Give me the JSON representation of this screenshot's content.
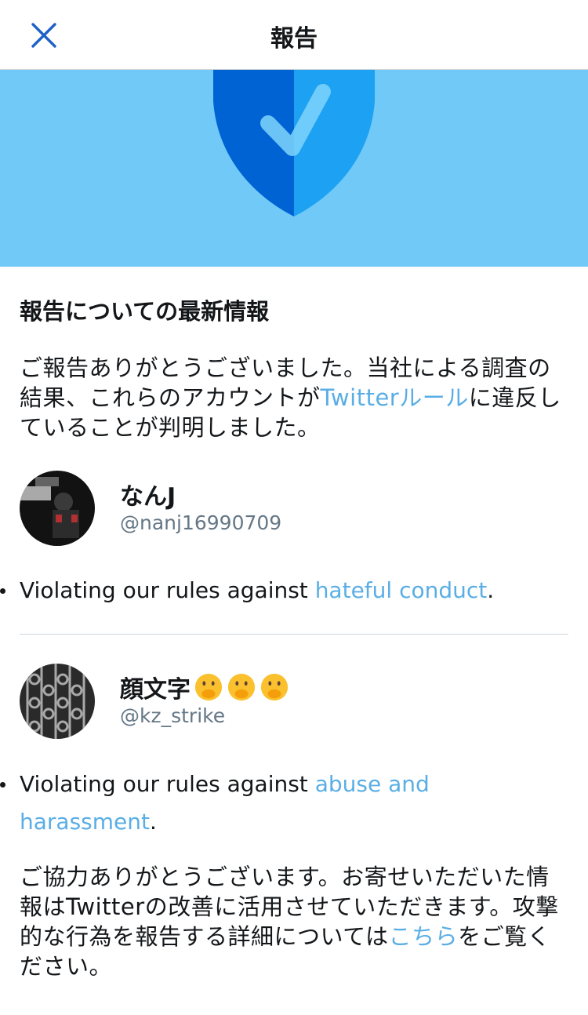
{
  "header": {
    "close_icon": "close-icon",
    "title": "報告"
  },
  "hero": {
    "icon": "shield-check-icon",
    "background_color": "#71c9f8"
  },
  "section": {
    "title": "報告についての最新情報",
    "intro_text": "ご報告ありがとうございました。当社による調査の結果、これらのアカウントが",
    "intro_link": "Twitterルール",
    "intro_suffix": "に違反していることが判明しました。"
  },
  "accounts": [
    {
      "name": "なんJ",
      "handle": "@nanj16990709",
      "violation_prefix": "Violating our rules against ",
      "violation_link": "hateful conduct",
      "violation_suffix": "."
    },
    {
      "name": "顔文字",
      "emojis": [
        "shushing-face-emoji",
        "shushing-face-emoji",
        "shushing-face-emoji"
      ],
      "handle": "@kz_strike",
      "violation_prefix": "Violating our rules against ",
      "violation_link": "abuse and harassment",
      "violation_suffix": "."
    }
  ],
  "footer": {
    "text": "ご協力ありがとうございます。お寄せいただいた情報はTwitterの改善に活用させていただきます。攻撃的な行為を報告する詳細については",
    "link": "こちら",
    "suffix": "をご覧ください。"
  },
  "colors": {
    "accent": "#1da1f2",
    "link": "#5aaee5",
    "close_icon": "#1d62c9",
    "shield_dark": "#0063d3",
    "shield_light": "#1da1f2"
  }
}
